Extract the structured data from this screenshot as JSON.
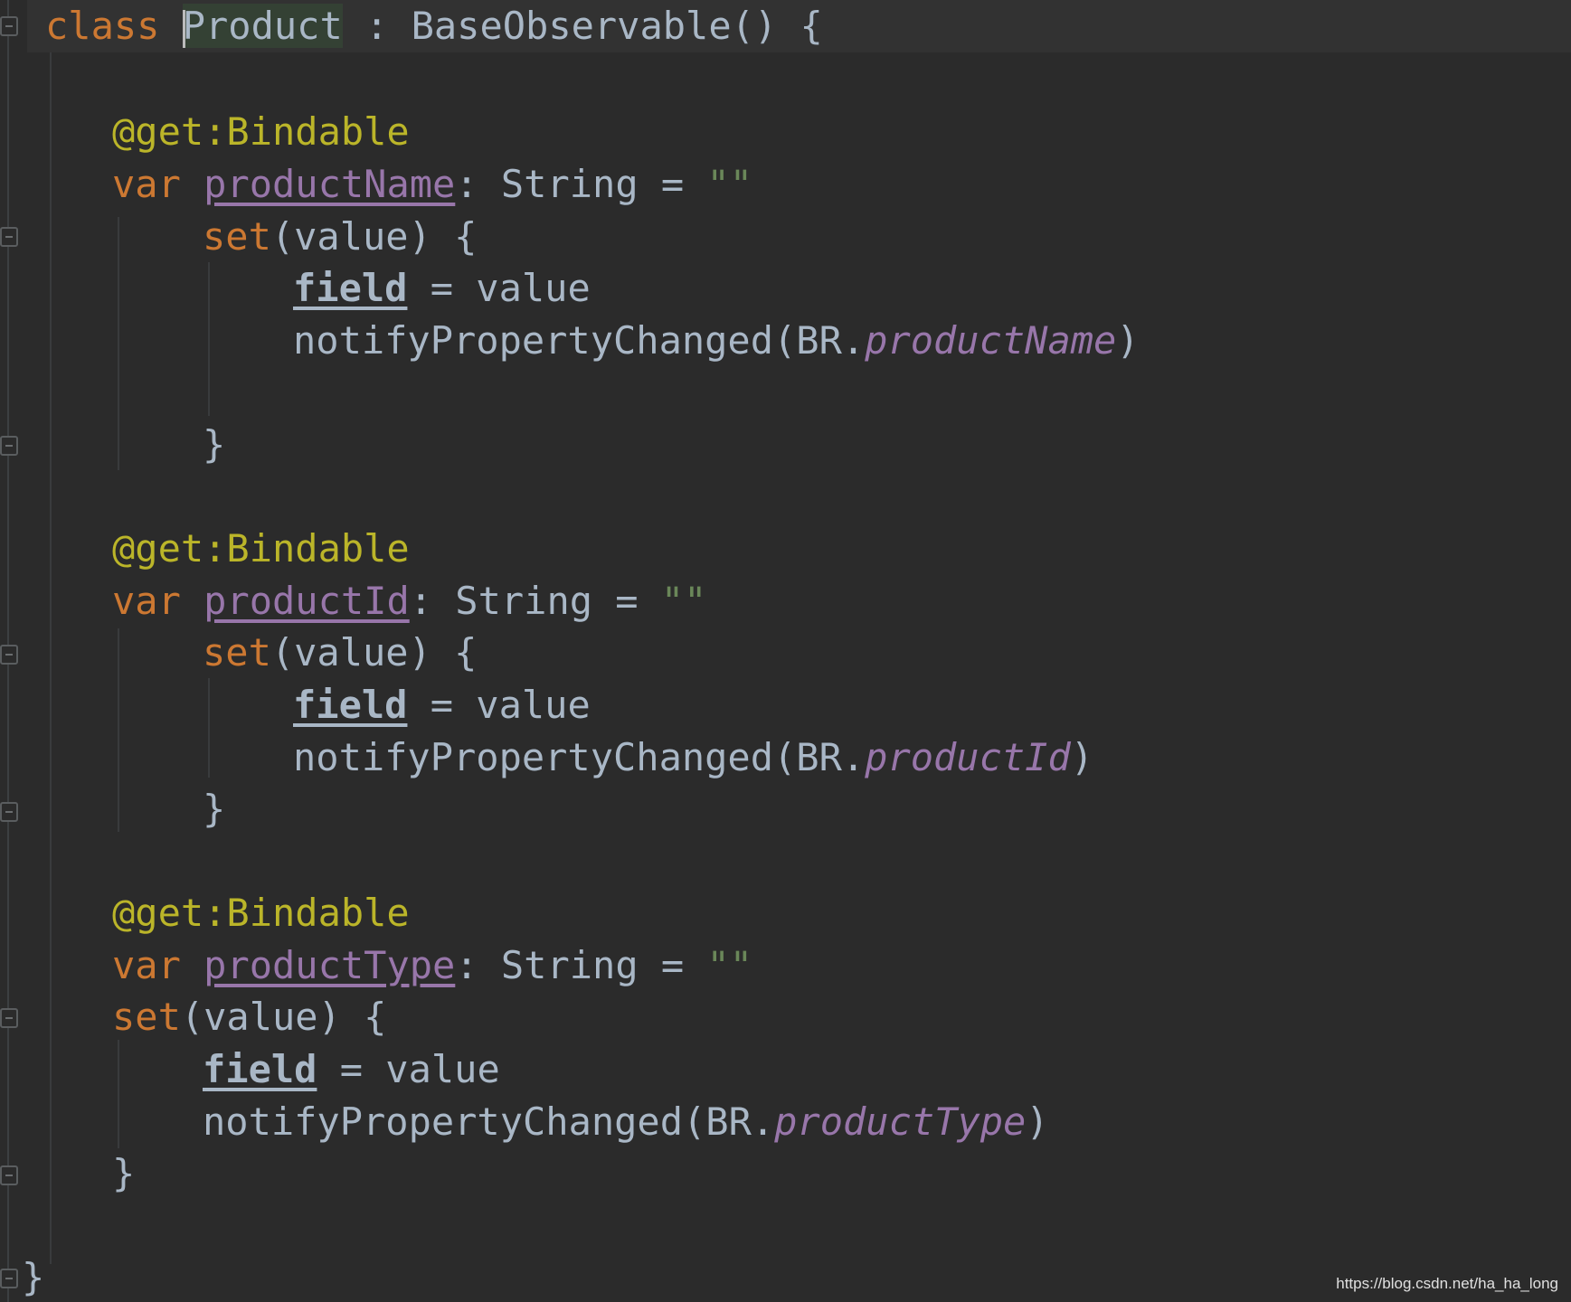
{
  "code": {
    "line1": {
      "kw_class": "class",
      "class_name": "Product",
      "rest": " : BaseObservable() {"
    },
    "block1": {
      "annotation": "@get:Bindable",
      "kw_var": "var",
      "prop_name": "productName",
      "type_decl": ": String = ",
      "init_value": "\"\"",
      "kw_set": "set",
      "set_args": "(value) {",
      "field_kw": "field",
      "assign": " = value",
      "notify_call": "notifyPropertyChanged(BR.",
      "br_prop": "productName",
      "close_paren": ")",
      "close_brace": "}"
    },
    "block2": {
      "annotation": "@get:Bindable",
      "kw_var": "var",
      "prop_name": "productId",
      "type_decl": ": String = ",
      "init_value": "\"\"",
      "kw_set": "set",
      "set_args": "(value) {",
      "field_kw": "field",
      "assign": " = value",
      "notify_call": "notifyPropertyChanged(BR.",
      "br_prop": "productId",
      "close_paren": ")",
      "close_brace": "}"
    },
    "block3": {
      "annotation": "@get:Bindable",
      "kw_var": "var",
      "prop_name": "productType",
      "type_decl": ": String = ",
      "init_value": "\"\"",
      "kw_set": "set",
      "set_args": "(value) {",
      "field_kw": "field",
      "assign": " = value",
      "notify_call": "notifyPropertyChanged(BR.",
      "br_prop": "productType",
      "close_paren": ")",
      "close_brace": "}"
    },
    "final_brace": "}"
  },
  "watermark": "https://blog.csdn.net/ha_ha_long",
  "colors": {
    "background": "#2b2b2b",
    "keyword": "#cc7832",
    "annotation": "#bbb529",
    "property": "#9876aa",
    "text": "#a9b7c6",
    "string": "#6a8759"
  }
}
